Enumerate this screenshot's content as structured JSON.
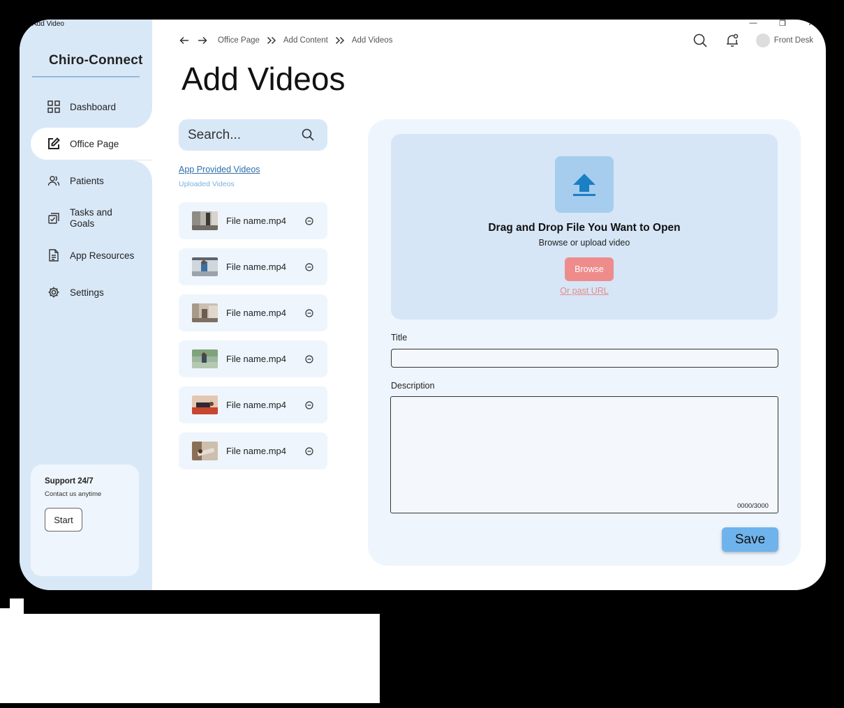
{
  "window": {
    "title": "Add Video",
    "minimize": "—",
    "restore": "❐",
    "close": "✕"
  },
  "sidebar": {
    "brand": "Chiro-Connect",
    "items": [
      {
        "label": "Dashboard",
        "icon": "dashboard-grid-icon",
        "active": false
      },
      {
        "label": "Office Page",
        "icon": "edit-square-icon",
        "active": true
      },
      {
        "label": "Patients",
        "icon": "users-icon",
        "active": false
      },
      {
        "label": "Tasks and Goals",
        "icon": "tasks-icon",
        "active": false
      },
      {
        "label": "App Resources",
        "icon": "document-icon",
        "active": false
      },
      {
        "label": "Settings",
        "icon": "gear-icon",
        "active": false
      }
    ],
    "support": {
      "title": "Support 24/7",
      "subtitle": "Contact us anytime",
      "button": "Start"
    }
  },
  "header": {
    "breadcrumbs": [
      "Office Page",
      "Add Content",
      "Add Videos"
    ],
    "user": "Front Desk"
  },
  "page_title": "Add Videos",
  "search": {
    "placeholder": "Search..."
  },
  "filters": {
    "app_provided": "App Provided Videos",
    "uploaded": "Uploaded Videos"
  },
  "files": [
    {
      "name": "File name.mp4"
    },
    {
      "name": "File name.mp4"
    },
    {
      "name": "File name.mp4"
    },
    {
      "name": "File name.mp4"
    },
    {
      "name": "File name.mp4"
    },
    {
      "name": "File name.mp4"
    }
  ],
  "upload": {
    "title": "Drag and Drop File You  Want to Open",
    "subtitle": "Browse or upload video",
    "browse": "Browse",
    "url_link": "Or past URL"
  },
  "form": {
    "title_label": "Title",
    "title_value": "",
    "description_label": "Description",
    "description_value": "",
    "counter": "0000/3000",
    "save": "Save"
  },
  "colors": {
    "sidebar_bg": "#d9e8f7",
    "panel_bg": "#eef5fd",
    "dropzone_bg": "#d6e6f6",
    "upload_accent": "#1a7fc4",
    "browse_button": "#ee8b8b",
    "save_button": "#6fb3ec"
  }
}
